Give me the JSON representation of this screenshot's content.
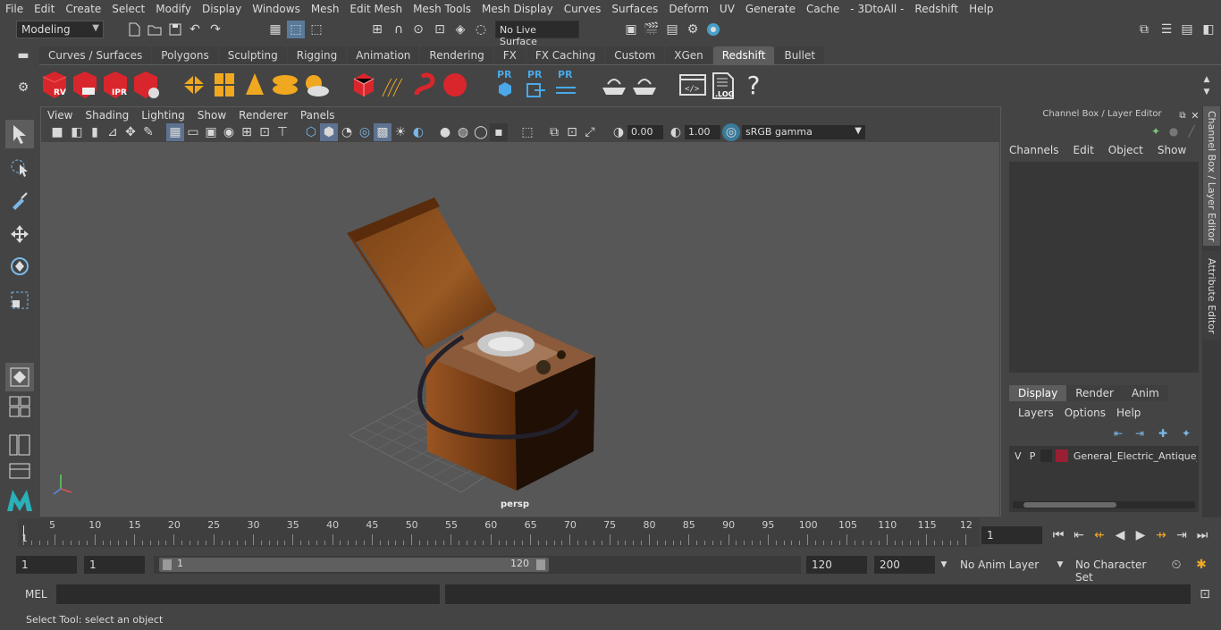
{
  "menu": [
    "File",
    "Edit",
    "Create",
    "Select",
    "Modify",
    "Display",
    "Windows",
    "Mesh",
    "Edit Mesh",
    "Mesh Tools",
    "Mesh Display",
    "Curves",
    "Surfaces",
    "Deform",
    "UV",
    "Generate",
    "Cache",
    "- 3DtoAll -",
    "Redshift",
    "Help"
  ],
  "status_line": {
    "mode": "Modeling",
    "live_surface": "No Live Surface"
  },
  "shelf": {
    "tabs": [
      "Curves / Surfaces",
      "Polygons",
      "Sculpting",
      "Rigging",
      "Animation",
      "Rendering",
      "FX",
      "FX Caching",
      "Custom",
      "XGen",
      "Redshift",
      "Bullet"
    ],
    "active_tab": "Redshift",
    "buttons": {
      "rv": "RV",
      "ipr": "IPR",
      "pr1": "PR",
      "pr2": "PR",
      "pr3": "PR",
      "log": ".LOG",
      "help": "?"
    }
  },
  "viewport": {
    "menus": [
      "View",
      "Shading",
      "Lighting",
      "Show",
      "Renderer",
      "Panels"
    ],
    "exposure": "0.00",
    "gamma": "1.00",
    "color_space": "sRGB gamma",
    "camera_label": "persp"
  },
  "channel_box": {
    "title": "Channel Box / Layer Editor",
    "menus": [
      "Channels",
      "Edit",
      "Object",
      "Show"
    ],
    "layer_tabs": [
      "Display",
      "Render",
      "Anim"
    ],
    "active_layer_tab": "Display",
    "layer_menus": [
      "Layers",
      "Options",
      "Help"
    ],
    "layer_row": {
      "v": "V",
      "p": "P",
      "color": "#9a1f33",
      "name": "General_Electric_Antique_"
    }
  },
  "side_tabs": [
    "Channel Box / Layer Editor",
    "Attribute Editor"
  ],
  "timeline": {
    "ticks": [
      "5",
      "10",
      "15",
      "20",
      "25",
      "30",
      "35",
      "40",
      "45",
      "50",
      "55",
      "60",
      "65",
      "70",
      "75",
      "80",
      "85",
      "90",
      "95",
      "100",
      "105",
      "110",
      "115",
      "12"
    ],
    "current_frame_marker": "1",
    "current_frame": "1"
  },
  "range": {
    "start": "1",
    "playback_start": "1",
    "slider_start": "1",
    "slider_end": "120",
    "playback_end": "120",
    "end": "200",
    "anim_layer": "No Anim Layer",
    "character_set": "No Character Set"
  },
  "command_line": {
    "label": "MEL"
  },
  "help_line": "Select Tool: select an object"
}
